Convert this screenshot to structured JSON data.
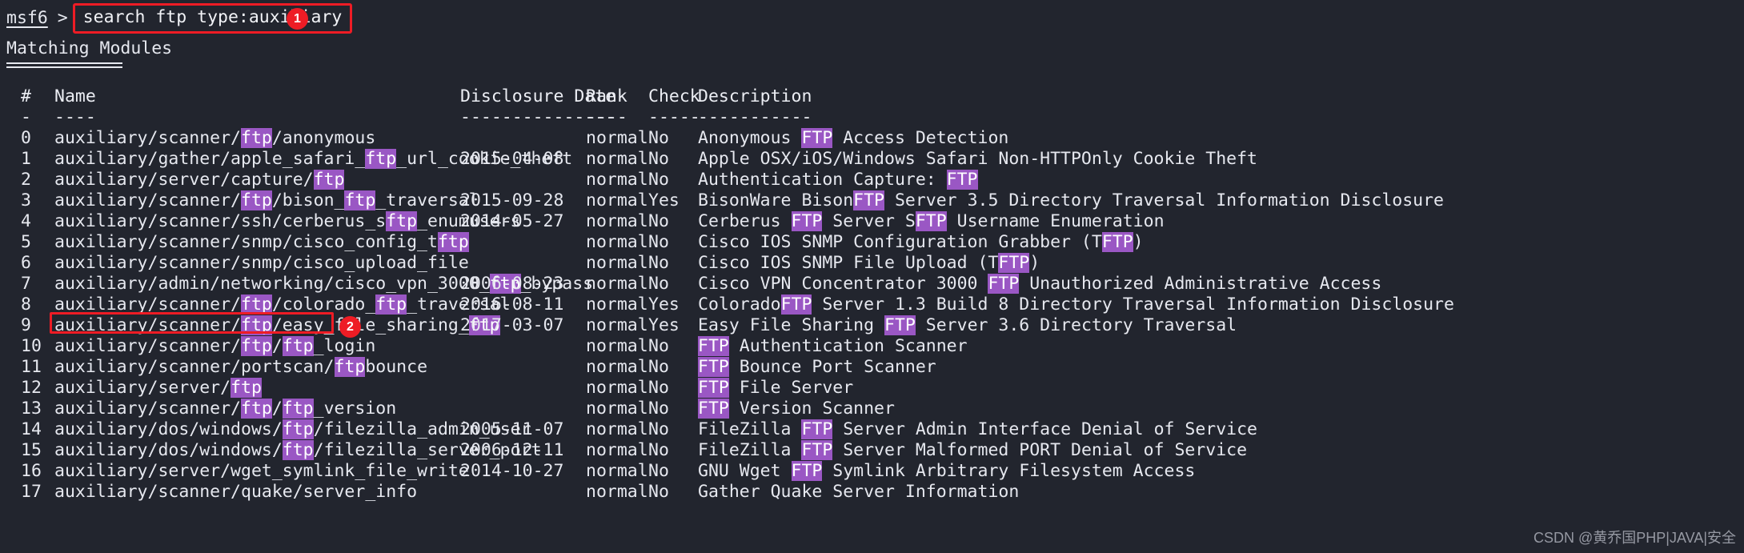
{
  "terminal": {
    "prompt": "msf6",
    "prompt_symbol": ">",
    "command": "search ftp type:auxiliary",
    "section_heading": "Matching Modules",
    "watermark": "CSDN @黄乔国PHP|JAVA|安全",
    "colors": {
      "background": "#22252e",
      "foreground": "#e6e8ef",
      "highlight_bg": "#9a57c4",
      "annotation": "#ee1c25"
    }
  },
  "annotations": [
    {
      "id": "1",
      "label": "1",
      "target": "command-input"
    },
    {
      "id": "2",
      "label": "2",
      "target": "module-row-13"
    }
  ],
  "table": {
    "columns": [
      "#",
      "Name",
      "Disclosure Date",
      "Rank",
      "Check",
      "Description"
    ],
    "separators": [
      "-",
      "----",
      "---------------",
      "----",
      "-----",
      "-----------"
    ],
    "rows": [
      {
        "index": "0",
        "name": "auxiliary/scanner/ftp/anonymous",
        "name_parts": [
          {
            "t": "auxiliary/scanner/",
            "h": false
          },
          {
            "t": "ftp",
            "h": true
          },
          {
            "t": "/anonymous",
            "h": false
          }
        ],
        "date": "",
        "rank": "normal",
        "check": "No",
        "description": "Anonymous FTP Access Detection",
        "desc_parts": [
          {
            "t": "Anonymous ",
            "h": false
          },
          {
            "t": "FTP",
            "h": true
          },
          {
            "t": " Access Detection",
            "h": false
          }
        ]
      },
      {
        "index": "1",
        "name": "auxiliary/gather/apple_safari_ftp_url_cookie_theft",
        "name_parts": [
          {
            "t": "auxiliary/gather/apple_safari_",
            "h": false
          },
          {
            "t": "ftp",
            "h": true
          },
          {
            "t": "_url_cookie_theft",
            "h": false
          }
        ],
        "date": "2015-04-08",
        "rank": "normal",
        "check": "No",
        "description": "Apple OSX/iOS/Windows Safari Non-HTTPOnly Cookie Theft",
        "desc_parts": [
          {
            "t": "Apple OSX/iOS/Windows Safari Non-HTTPOnly Cookie Theft",
            "h": false
          }
        ]
      },
      {
        "index": "2",
        "name": "auxiliary/server/capture/ftp",
        "name_parts": [
          {
            "t": "auxiliary/server/capture/",
            "h": false
          },
          {
            "t": "ftp",
            "h": true
          }
        ],
        "date": "",
        "rank": "normal",
        "check": "No",
        "description": "Authentication Capture: FTP",
        "desc_parts": [
          {
            "t": "Authentication Capture: ",
            "h": false
          },
          {
            "t": "FTP",
            "h": true
          }
        ]
      },
      {
        "index": "3",
        "name": "auxiliary/scanner/ftp/bison_ftp_traversal",
        "name_parts": [
          {
            "t": "auxiliary/scanner/",
            "h": false
          },
          {
            "t": "ftp",
            "h": true
          },
          {
            "t": "/bison_",
            "h": false
          },
          {
            "t": "ftp",
            "h": true
          },
          {
            "t": "_traversal",
            "h": false
          }
        ],
        "date": "2015-09-28",
        "rank": "normal",
        "check": "Yes",
        "description": "BisonWare BisonFTP Server 3.5 Directory Traversal Information Disclosure",
        "desc_parts": [
          {
            "t": "BisonWare Bison",
            "h": false
          },
          {
            "t": "FTP",
            "h": true
          },
          {
            "t": " Server 3.5 Directory Traversal Information Disclosure",
            "h": false
          }
        ]
      },
      {
        "index": "4",
        "name": "auxiliary/scanner/ssh/cerberus_sftp_enumusers",
        "name_parts": [
          {
            "t": "auxiliary/scanner/ssh/cerberus_s",
            "h": false
          },
          {
            "t": "ftp",
            "h": true
          },
          {
            "t": "_enumusers",
            "h": false
          }
        ],
        "date": "2014-05-27",
        "rank": "normal",
        "check": "No",
        "description": "Cerberus FTP Server SFTP Username Enumeration",
        "desc_parts": [
          {
            "t": "Cerberus ",
            "h": false
          },
          {
            "t": "FTP",
            "h": true
          },
          {
            "t": " Server S",
            "h": false
          },
          {
            "t": "FTP",
            "h": true
          },
          {
            "t": " Username Enumeration",
            "h": false
          }
        ]
      },
      {
        "index": "5",
        "name": "auxiliary/scanner/snmp/cisco_config_tftp",
        "name_parts": [
          {
            "t": "auxiliary/scanner/snmp/cisco_config_t",
            "h": false
          },
          {
            "t": "ftp",
            "h": true
          }
        ],
        "date": "",
        "rank": "normal",
        "check": "No",
        "description": "Cisco IOS SNMP Configuration Grabber (TFTP)",
        "desc_parts": [
          {
            "t": "Cisco IOS SNMP Configuration Grabber (T",
            "h": false
          },
          {
            "t": "FTP",
            "h": true
          },
          {
            "t": ")",
            "h": false
          }
        ]
      },
      {
        "index": "6",
        "name": "auxiliary/scanner/snmp/cisco_upload_file",
        "name_parts": [
          {
            "t": "auxiliary/scanner/snmp/cisco_upload_file",
            "h": false
          }
        ],
        "date": "",
        "rank": "normal",
        "check": "No",
        "description": "Cisco IOS SNMP File Upload (TFTP)",
        "desc_parts": [
          {
            "t": "Cisco IOS SNMP File Upload (T",
            "h": false
          },
          {
            "t": "FTP",
            "h": true
          },
          {
            "t": ")",
            "h": false
          }
        ]
      },
      {
        "index": "7",
        "name": "auxiliary/admin/networking/cisco_vpn_3000_ftp_bypass",
        "name_parts": [
          {
            "t": "auxiliary/admin/networking/cisco_vpn_3000_",
            "h": false
          },
          {
            "t": "ftp",
            "h": true
          },
          {
            "t": "_bypass",
            "h": false
          }
        ],
        "date": "2006-08-23",
        "rank": "normal",
        "check": "No",
        "description": "Cisco VPN Concentrator 3000 FTP Unauthorized Administrative Access",
        "desc_parts": [
          {
            "t": "Cisco VPN Concentrator 3000 ",
            "h": false
          },
          {
            "t": "FTP",
            "h": true
          },
          {
            "t": " Unauthorized Administrative Access",
            "h": false
          }
        ]
      },
      {
        "index": "8",
        "name": "auxiliary/scanner/ftp/colorado_ftp_traversal",
        "name_parts": [
          {
            "t": "auxiliary/scanner/",
            "h": false
          },
          {
            "t": "ftp",
            "h": true
          },
          {
            "t": "/colorado_",
            "h": false
          },
          {
            "t": "ftp",
            "h": true
          },
          {
            "t": "_traversal",
            "h": false
          }
        ],
        "date": "2016-08-11",
        "rank": "normal",
        "check": "Yes",
        "description": "ColoradoFTP Server 1.3 Build 8 Directory Traversal Information Disclosure",
        "desc_parts": [
          {
            "t": "Colorado",
            "h": false
          },
          {
            "t": "FTP",
            "h": true
          },
          {
            "t": " Server 1.3 Build 8 Directory Traversal Information Disclosure",
            "h": false
          }
        ]
      },
      {
        "index": "9",
        "name": "auxiliary/scanner/ftp/easy_file_sharing_ftp",
        "name_parts": [
          {
            "t": "auxiliary/scanner/",
            "h": false
          },
          {
            "t": "ftp",
            "h": true
          },
          {
            "t": "/easy_file_sharing_",
            "h": false
          },
          {
            "t": "ftp",
            "h": true
          }
        ],
        "date": "2017-03-07",
        "rank": "normal",
        "check": "Yes",
        "description": "Easy File Sharing FTP Server 3.6 Directory Traversal",
        "desc_parts": [
          {
            "t": "Easy File Sharing ",
            "h": false
          },
          {
            "t": "FTP",
            "h": true
          },
          {
            "t": " Server 3.6 Directory Traversal",
            "h": false
          }
        ]
      },
      {
        "index": "10",
        "name": "auxiliary/scanner/ftp/ftp_login",
        "name_parts": [
          {
            "t": "auxiliary/scanner/",
            "h": false
          },
          {
            "t": "ftp",
            "h": true
          },
          {
            "t": "/",
            "h": false
          },
          {
            "t": "ftp",
            "h": true
          },
          {
            "t": "_login",
            "h": false
          }
        ],
        "date": "",
        "rank": "normal",
        "check": "No",
        "description": "FTP Authentication Scanner",
        "desc_parts": [
          {
            "t": "FTP",
            "h": true
          },
          {
            "t": " Authentication Scanner",
            "h": false
          }
        ]
      },
      {
        "index": "11",
        "name": "auxiliary/scanner/portscan/ftpbounce",
        "name_parts": [
          {
            "t": "auxiliary/scanner/portscan/",
            "h": false
          },
          {
            "t": "ftp",
            "h": true
          },
          {
            "t": "bounce",
            "h": false
          }
        ],
        "date": "",
        "rank": "normal",
        "check": "No",
        "description": "FTP Bounce Port Scanner",
        "desc_parts": [
          {
            "t": "FTP",
            "h": true
          },
          {
            "t": " Bounce Port Scanner",
            "h": false
          }
        ]
      },
      {
        "index": "12",
        "name": "auxiliary/server/ftp",
        "name_parts": [
          {
            "t": "auxiliary/server/",
            "h": false
          },
          {
            "t": "ftp",
            "h": true
          }
        ],
        "date": "",
        "rank": "normal",
        "check": "No",
        "description": "FTP File Server",
        "desc_parts": [
          {
            "t": "FTP",
            "h": true
          },
          {
            "t": " File Server",
            "h": false
          }
        ]
      },
      {
        "index": "13",
        "name": "auxiliary/scanner/ftp/ftp_version",
        "name_parts": [
          {
            "t": "auxiliary/scanner/",
            "h": false
          },
          {
            "t": "ftp",
            "h": true
          },
          {
            "t": "/",
            "h": false
          },
          {
            "t": "ftp",
            "h": true
          },
          {
            "t": "_version",
            "h": false
          }
        ],
        "date": "",
        "rank": "normal",
        "check": "No",
        "description": "FTP Version Scanner",
        "desc_parts": [
          {
            "t": "FTP",
            "h": true
          },
          {
            "t": " Version Scanner",
            "h": false
          }
        ],
        "highlighted": true
      },
      {
        "index": "14",
        "name": "auxiliary/dos/windows/ftp/filezilla_admin_user",
        "name_parts": [
          {
            "t": "auxiliary/dos/windows/",
            "h": false
          },
          {
            "t": "ftp",
            "h": true
          },
          {
            "t": "/filezilla_admin_user",
            "h": false
          }
        ],
        "date": "2005-11-07",
        "rank": "normal",
        "check": "No",
        "description": "FileZilla FTP Server Admin Interface Denial of Service",
        "desc_parts": [
          {
            "t": "FileZilla ",
            "h": false
          },
          {
            "t": "FTP",
            "h": true
          },
          {
            "t": " Server Admin Interface Denial of Service",
            "h": false
          }
        ]
      },
      {
        "index": "15",
        "name": "auxiliary/dos/windows/ftp/filezilla_server_port",
        "name_parts": [
          {
            "t": "auxiliary/dos/windows/",
            "h": false
          },
          {
            "t": "ftp",
            "h": true
          },
          {
            "t": "/filezilla_server_port",
            "h": false
          }
        ],
        "date": "2006-12-11",
        "rank": "normal",
        "check": "No",
        "description": "FileZilla FTP Server Malformed PORT Denial of Service",
        "desc_parts": [
          {
            "t": "FileZilla ",
            "h": false
          },
          {
            "t": "FTP",
            "h": true
          },
          {
            "t": " Server Malformed PORT Denial of Service",
            "h": false
          }
        ]
      },
      {
        "index": "16",
        "name": "auxiliary/server/wget_symlink_file_write",
        "name_parts": [
          {
            "t": "auxiliary/server/wget_symlink_file_write",
            "h": false
          }
        ],
        "date": "2014-10-27",
        "rank": "normal",
        "check": "No",
        "description": "GNU Wget FTP Symlink Arbitrary Filesystem Access",
        "desc_parts": [
          {
            "t": "GNU Wget ",
            "h": false
          },
          {
            "t": "FTP",
            "h": true
          },
          {
            "t": " Symlink Arbitrary Filesystem Access",
            "h": false
          }
        ]
      },
      {
        "index": "17",
        "name": "auxiliary/scanner/quake/server_info",
        "name_parts": [
          {
            "t": "auxiliary/scanner/quake/server_info",
            "h": false
          }
        ],
        "date": "",
        "rank": "normal",
        "check": "No",
        "description": "Gather Quake Server Information",
        "desc_parts": [
          {
            "t": "Gather Quake Server Information",
            "h": false
          }
        ]
      }
    ]
  }
}
